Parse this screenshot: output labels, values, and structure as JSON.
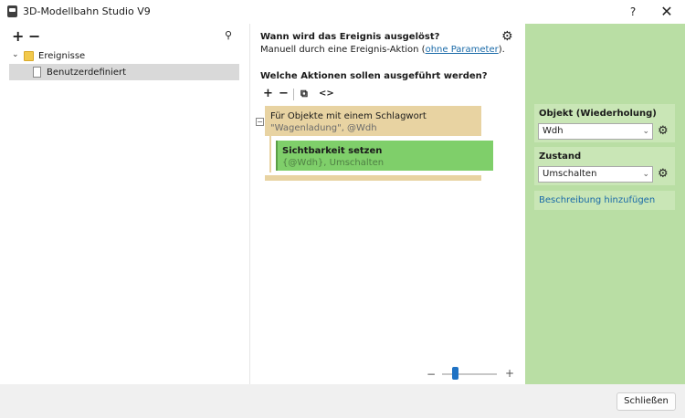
{
  "window": {
    "title": "3D-Modellbahn Studio V9",
    "help_label": "?",
    "close_label": "✕"
  },
  "left": {
    "add_label": "+",
    "remove_label": "−",
    "search_icon": "⚲",
    "tree": [
      {
        "label": "Ereignisse",
        "expanded": true
      },
      {
        "label": "Benutzerdefiniert",
        "selected": true
      }
    ]
  },
  "center": {
    "trigger_heading": "Wann wird das Ereignis ausgelöst?",
    "trigger_text_before": "Manuell durch eine Ereignis-Aktion (",
    "trigger_link": "ohne Parameter",
    "trigger_text_after": ").",
    "actions_heading": "Welche Aktionen sollen ausgeführt werden?",
    "action_toolbar": {
      "add": "+",
      "remove": "−",
      "copy": "⧉",
      "code": "<>"
    },
    "collapse_symbol": "−",
    "loop_block": {
      "title": "Für Objekte mit einem Schlagwort",
      "subtitle": "\"Wagenladung\", @Wdh"
    },
    "action_block": {
      "title": "Sichtbarkeit setzen",
      "subtitle": "{@Wdh}, Umschalten"
    },
    "zoom": {
      "minus": "−",
      "plus": "+",
      "level": 0.25
    }
  },
  "right": {
    "object_label": "Objekt (Wiederholung)",
    "object_value": "Wdh",
    "state_label": "Zustand",
    "state_value": "Umschalten",
    "description_link": "Beschreibung hinzufügen"
  },
  "footer": {
    "close_button": "Schließen"
  },
  "colors": {
    "loop_block": "#e8d3a2",
    "action_block": "#7fcf6a",
    "properties_panel": "#b9dea4",
    "link": "#1a6aa8"
  }
}
